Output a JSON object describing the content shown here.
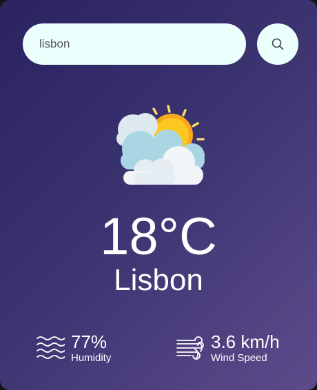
{
  "search": {
    "value": "lisbon",
    "icon": "search-icon"
  },
  "weather": {
    "icon": "partly-cloudy-icon",
    "temperature": "18°C",
    "city": "Lisbon"
  },
  "details": {
    "humidity": {
      "icon": "humidity-icon",
      "value": "77%",
      "label": "Humidity"
    },
    "wind": {
      "icon": "wind-icon",
      "value": "3.6 km/h",
      "label": "Wind Speed"
    }
  },
  "colors": {
    "background_start": "#2a2360",
    "background_end": "#5d4b8a",
    "input_background": "#ebfffc",
    "text": "#ffffff"
  }
}
